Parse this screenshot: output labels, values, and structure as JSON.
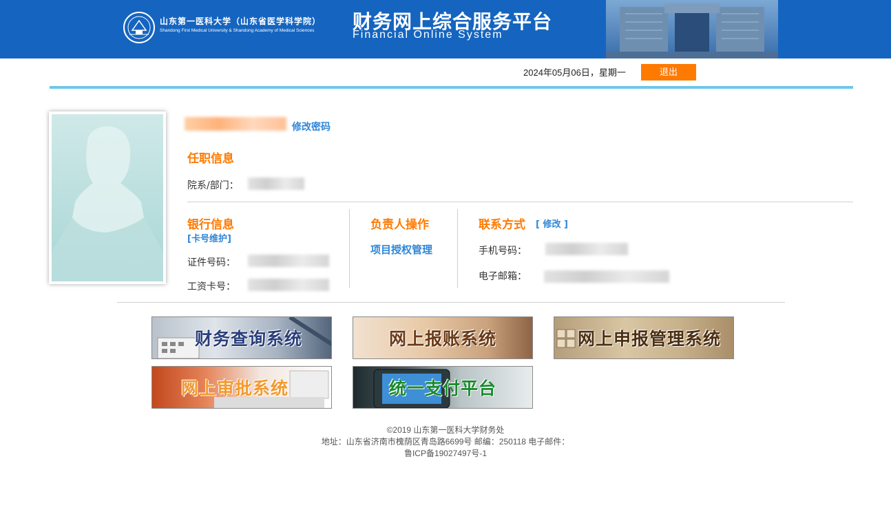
{
  "header": {
    "school_name_cn": "山东第一医科大学（山东省医学科学院）",
    "school_name_en": "Shandong First Medical University & Shandong Academy of Medical Sciences",
    "system_title": "财务网上综合服务平台",
    "system_subtitle": "Financial Online System",
    "brand_color": "#1565c0"
  },
  "topbar": {
    "date_text": "2024年05月06日，星期一",
    "logout_label": "退出",
    "logout_color": "#ff7a00"
  },
  "profile": {
    "change_password_label": "修改密码"
  },
  "position_info": {
    "title": "任职信息",
    "department_label": "院系/部门："
  },
  "bank_info": {
    "title": "银行信息",
    "card_maintain_label": "[卡号维护]",
    "id_label": "证件号码：",
    "salary_card_label": "工资卡号："
  },
  "manager_ops": {
    "title": "负责人操作",
    "project_auth_label": "项目授权管理"
  },
  "contact": {
    "title": "联系方式",
    "modify_label": "[ 修改 ]",
    "phone_label": "手机号码：",
    "email_label": "电子邮箱："
  },
  "systems": [
    {
      "label": "财务查询系统",
      "icon": "finance-query"
    },
    {
      "label": "网上报账系统",
      "icon": "online-reimbursement"
    },
    {
      "label": "网上申报管理系统",
      "icon": "online-declaration"
    },
    {
      "label": "网上审批系统",
      "icon": "online-approval"
    },
    {
      "label": "统一支付平台",
      "icon": "unified-payment"
    }
  ],
  "footer": {
    "copyright": "©2019 山东第一医科大学财务处",
    "address": "地址：山东省济南市槐荫区青岛路6699号 邮编：250118 电子邮件：",
    "icp": "鲁ICP备19027497号-1"
  }
}
